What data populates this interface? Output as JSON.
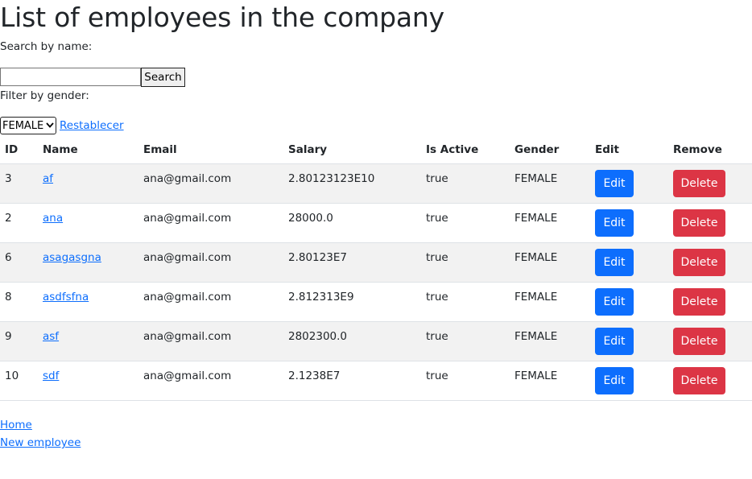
{
  "page": {
    "title": "List of employees in the company",
    "search_label": "Search by name:",
    "search_value": "",
    "search_button": "Search",
    "filter_label": "Filter by gender:",
    "gender_selected": "FEMALE",
    "reset_link": "Restablecer"
  },
  "table": {
    "headers": [
      "ID",
      "Name",
      "Email",
      "Salary",
      "Is Active",
      "Gender",
      "Edit",
      "Remove"
    ],
    "rows": [
      {
        "id": "3",
        "name": "af",
        "email": "ana@gmail.com",
        "salary": "2.80123123E10",
        "active": "true",
        "gender": "FEMALE",
        "edit": "Edit",
        "delete": "Delete"
      },
      {
        "id": "2",
        "name": "ana",
        "email": "ana@gmail.com",
        "salary": "28000.0",
        "active": "true",
        "gender": "FEMALE",
        "edit": "Edit",
        "delete": "Delete"
      },
      {
        "id": "6",
        "name": "asagasgna",
        "email": "ana@gmail.com",
        "salary": "2.80123E7",
        "active": "true",
        "gender": "FEMALE",
        "edit": "Edit",
        "delete": "Delete"
      },
      {
        "id": "8",
        "name": "asdfsfna",
        "email": "ana@gmail.com",
        "salary": "2.812313E9",
        "active": "true",
        "gender": "FEMALE",
        "edit": "Edit",
        "delete": "Delete"
      },
      {
        "id": "9",
        "name": "asf",
        "email": "ana@gmail.com",
        "salary": "2802300.0",
        "active": "true",
        "gender": "FEMALE",
        "edit": "Edit",
        "delete": "Delete"
      },
      {
        "id": "10",
        "name": "sdf",
        "email": "ana@gmail.com",
        "salary": "2.1238E7",
        "active": "true",
        "gender": "FEMALE",
        "edit": "Edit",
        "delete": "Delete"
      }
    ]
  },
  "footer": {
    "home_link": "Home",
    "new_employee_link": "New employee"
  },
  "colors": {
    "edit_button": "#0d6efd",
    "delete_button": "#dc3545",
    "link": "#0d6efd",
    "striped_row": "#f2f2f2"
  }
}
